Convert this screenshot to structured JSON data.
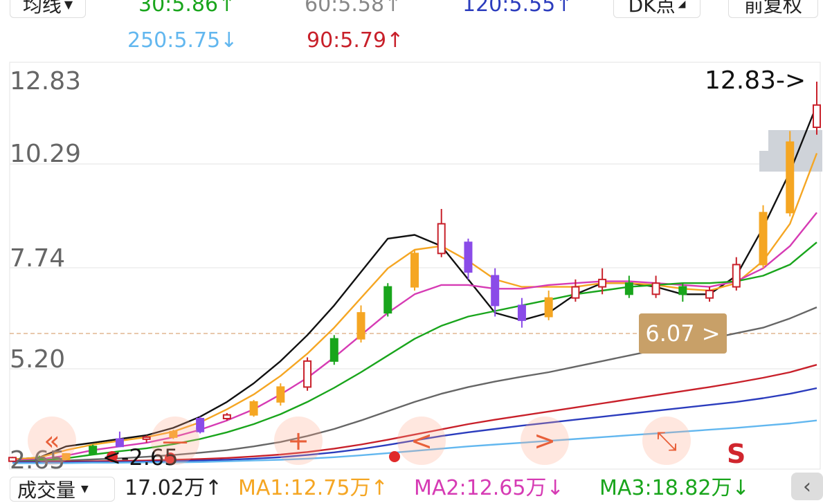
{
  "toolbar": {
    "ma_button": "均线",
    "dk_button": "DK点",
    "adjust_button": "前复权"
  },
  "ma_labels": [
    {
      "text": "30:5.86↑",
      "color": "#19a51c"
    },
    {
      "text": "60:5.58↑",
      "color": "#888888"
    },
    {
      "text": "120:5.55↑",
      "color": "#2b3cbd"
    },
    {
      "text": "250:5.75↓",
      "color": "#62b7ef"
    },
    {
      "text": "90:5.79↑",
      "color": "#c8202a"
    }
  ],
  "y_axis": [
    "12.83",
    "10.29",
    "7.74",
    "5.20",
    "2.65"
  ],
  "markers": {
    "high": "12.83->",
    "low": "<-2.65",
    "callout": "6.07 >",
    "sell": "S"
  },
  "controls": {
    "rewind": "«",
    "zoom_out": "—",
    "zoom_in": "+",
    "prev": "<",
    "next": ">",
    "fullscreen": "⤡"
  },
  "volume": {
    "selector": "成交量",
    "total": {
      "text": "17.02万↑",
      "color": "#222222"
    },
    "ma1": {
      "text": "MA1:12.75万↑",
      "color": "#f5a623"
    },
    "ma2": {
      "text": "MA2:12.65万↓",
      "color": "#d63bb4"
    },
    "ma3": {
      "text": "MA3:18.82万↓",
      "color": "#19a51c"
    }
  },
  "colors": {
    "up": "#c8202a",
    "down": "#19a51c",
    "flat_bull": "#f5a623",
    "purple": "#8a4be8",
    "grid": "#e3e3e3",
    "callout_bg": "#c8a068"
  },
  "chart_data": {
    "type": "line",
    "title": "",
    "ylim": [
      2.65,
      12.83
    ],
    "y_ticks": [
      12.83,
      10.29,
      7.74,
      5.2,
      2.65
    ],
    "series": [
      {
        "name": "",
        "color": "#111111",
        "values": [
          2.65,
          2.7,
          3.0,
          3.1,
          3.2,
          3.3,
          3.5,
          3.8,
          4.2,
          4.7,
          5.3,
          6.0,
          6.8,
          7.7,
          8.6,
          8.7,
          8.4,
          7.5,
          6.6,
          6.4,
          6.6,
          7.1,
          7.4,
          7.4,
          7.3,
          7.1,
          7.1,
          7.6,
          8.9,
          10.4,
          12.2
        ]
      },
      {
        "name": "",
        "color": "#f5a623",
        "values": [
          2.65,
          2.7,
          2.9,
          3.05,
          3.15,
          3.25,
          3.4,
          3.65,
          4.0,
          4.4,
          4.9,
          5.5,
          6.2,
          7.0,
          7.8,
          8.3,
          8.4,
          8.0,
          7.5,
          7.3,
          7.3,
          7.3,
          7.4,
          7.4,
          7.35,
          7.25,
          7.2,
          7.4,
          8.0,
          9.0,
          10.9
        ]
      },
      {
        "name": "",
        "color": "#d63bb4",
        "values": [
          2.62,
          2.65,
          2.75,
          2.9,
          3.0,
          3.1,
          3.25,
          3.45,
          3.7,
          4.0,
          4.4,
          4.85,
          5.4,
          6.0,
          6.6,
          7.1,
          7.35,
          7.35,
          7.25,
          7.25,
          7.35,
          7.4,
          7.45,
          7.45,
          7.4,
          7.35,
          7.3,
          7.45,
          7.8,
          8.4,
          9.3
        ]
      },
      {
        "name": "",
        "color": "#19a51c",
        "values": [
          2.6,
          2.62,
          2.68,
          2.78,
          2.87,
          2.95,
          3.06,
          3.2,
          3.38,
          3.6,
          3.87,
          4.2,
          4.58,
          5.0,
          5.45,
          5.9,
          6.25,
          6.5,
          6.65,
          6.8,
          6.95,
          7.1,
          7.2,
          7.3,
          7.35,
          7.4,
          7.4,
          7.45,
          7.6,
          7.9,
          8.5
        ]
      },
      {
        "name": "",
        "color": "#666666",
        "values": [
          2.6,
          2.6,
          2.62,
          2.65,
          2.68,
          2.72,
          2.77,
          2.83,
          2.9,
          3.0,
          3.12,
          3.28,
          3.47,
          3.7,
          3.95,
          4.2,
          4.42,
          4.6,
          4.75,
          4.88,
          5.0,
          5.15,
          5.3,
          5.45,
          5.6,
          5.75,
          5.9,
          6.05,
          6.2,
          6.45,
          6.75
        ]
      },
      {
        "name": "",
        "color": "#c8202a",
        "values": [
          2.58,
          2.58,
          2.59,
          2.6,
          2.61,
          2.62,
          2.64,
          2.66,
          2.69,
          2.73,
          2.78,
          2.85,
          2.94,
          3.05,
          3.18,
          3.32,
          3.46,
          3.6,
          3.72,
          3.83,
          3.94,
          4.05,
          4.16,
          4.27,
          4.38,
          4.49,
          4.6,
          4.72,
          4.85,
          5.0,
          5.2
        ]
      },
      {
        "name": "",
        "color": "#2b3cbd",
        "values": [
          2.57,
          2.57,
          2.57,
          2.58,
          2.58,
          2.59,
          2.6,
          2.62,
          2.64,
          2.67,
          2.71,
          2.77,
          2.84,
          2.93,
          3.04,
          3.16,
          3.28,
          3.38,
          3.47,
          3.56,
          3.64,
          3.72,
          3.8,
          3.88,
          3.96,
          4.04,
          4.12,
          4.2,
          4.3,
          4.42,
          4.57
        ]
      },
      {
        "name": "",
        "color": "#62b7ef",
        "values": [
          2.55,
          2.55,
          2.55,
          2.56,
          2.56,
          2.57,
          2.57,
          2.58,
          2.6,
          2.62,
          2.64,
          2.67,
          2.71,
          2.76,
          2.82,
          2.88,
          2.94,
          3.0,
          3.05,
          3.1,
          3.15,
          3.2,
          3.25,
          3.3,
          3.35,
          3.4,
          3.45,
          3.5,
          3.56,
          3.62,
          3.7
        ]
      }
    ],
    "candles": [
      [
        2.6,
        2.7,
        2.58,
        2.72,
        "up"
      ],
      [
        2.7,
        2.65,
        2.62,
        2.75,
        "down"
      ],
      [
        2.65,
        2.8,
        2.63,
        2.82,
        "flat"
      ],
      [
        2.8,
        3.0,
        2.78,
        3.05,
        "down"
      ],
      [
        3.0,
        3.2,
        2.98,
        3.4,
        "purple"
      ],
      [
        3.2,
        3.25,
        3.1,
        3.3,
        "up"
      ],
      [
        3.25,
        3.4,
        3.2,
        3.45,
        "flat"
      ],
      [
        3.4,
        3.75,
        3.35,
        3.8,
        "purple"
      ],
      [
        3.75,
        3.85,
        3.7,
        3.9,
        "up"
      ],
      [
        3.85,
        4.2,
        3.8,
        4.25,
        "flat"
      ],
      [
        4.2,
        4.6,
        4.1,
        4.7,
        "flat"
      ],
      [
        4.6,
        5.3,
        4.5,
        5.4,
        "up"
      ],
      [
        5.3,
        5.9,
        5.2,
        6.0,
        "down"
      ],
      [
        5.9,
        6.6,
        5.8,
        6.8,
        "flat"
      ],
      [
        6.6,
        7.3,
        6.5,
        7.4,
        "down"
      ],
      [
        7.3,
        8.2,
        7.2,
        8.3,
        "flat"
      ],
      [
        8.2,
        9.0,
        8.1,
        9.4,
        "up"
      ],
      [
        8.5,
        7.7,
        7.5,
        8.6,
        "purple"
      ],
      [
        7.6,
        6.8,
        6.5,
        7.8,
        "purple"
      ],
      [
        6.8,
        6.4,
        6.2,
        7.0,
        "purple"
      ],
      [
        6.5,
        7.0,
        6.4,
        7.2,
        "flat"
      ],
      [
        7.0,
        7.3,
        6.9,
        7.5,
        "up"
      ],
      [
        7.3,
        7.5,
        7.1,
        7.8,
        "up"
      ],
      [
        7.4,
        7.1,
        7.0,
        7.6,
        "down"
      ],
      [
        7.1,
        7.4,
        7.0,
        7.6,
        "up"
      ],
      [
        7.3,
        7.1,
        6.9,
        7.4,
        "down"
      ],
      [
        7.0,
        7.2,
        6.9,
        7.3,
        "up"
      ],
      [
        7.3,
        7.9,
        7.2,
        8.1,
        "up"
      ],
      [
        7.9,
        9.3,
        7.8,
        9.5,
        "flat"
      ],
      [
        9.3,
        11.2,
        9.2,
        11.5,
        "flat"
      ],
      [
        12.2,
        11.6,
        11.4,
        12.83,
        "up"
      ]
    ]
  }
}
